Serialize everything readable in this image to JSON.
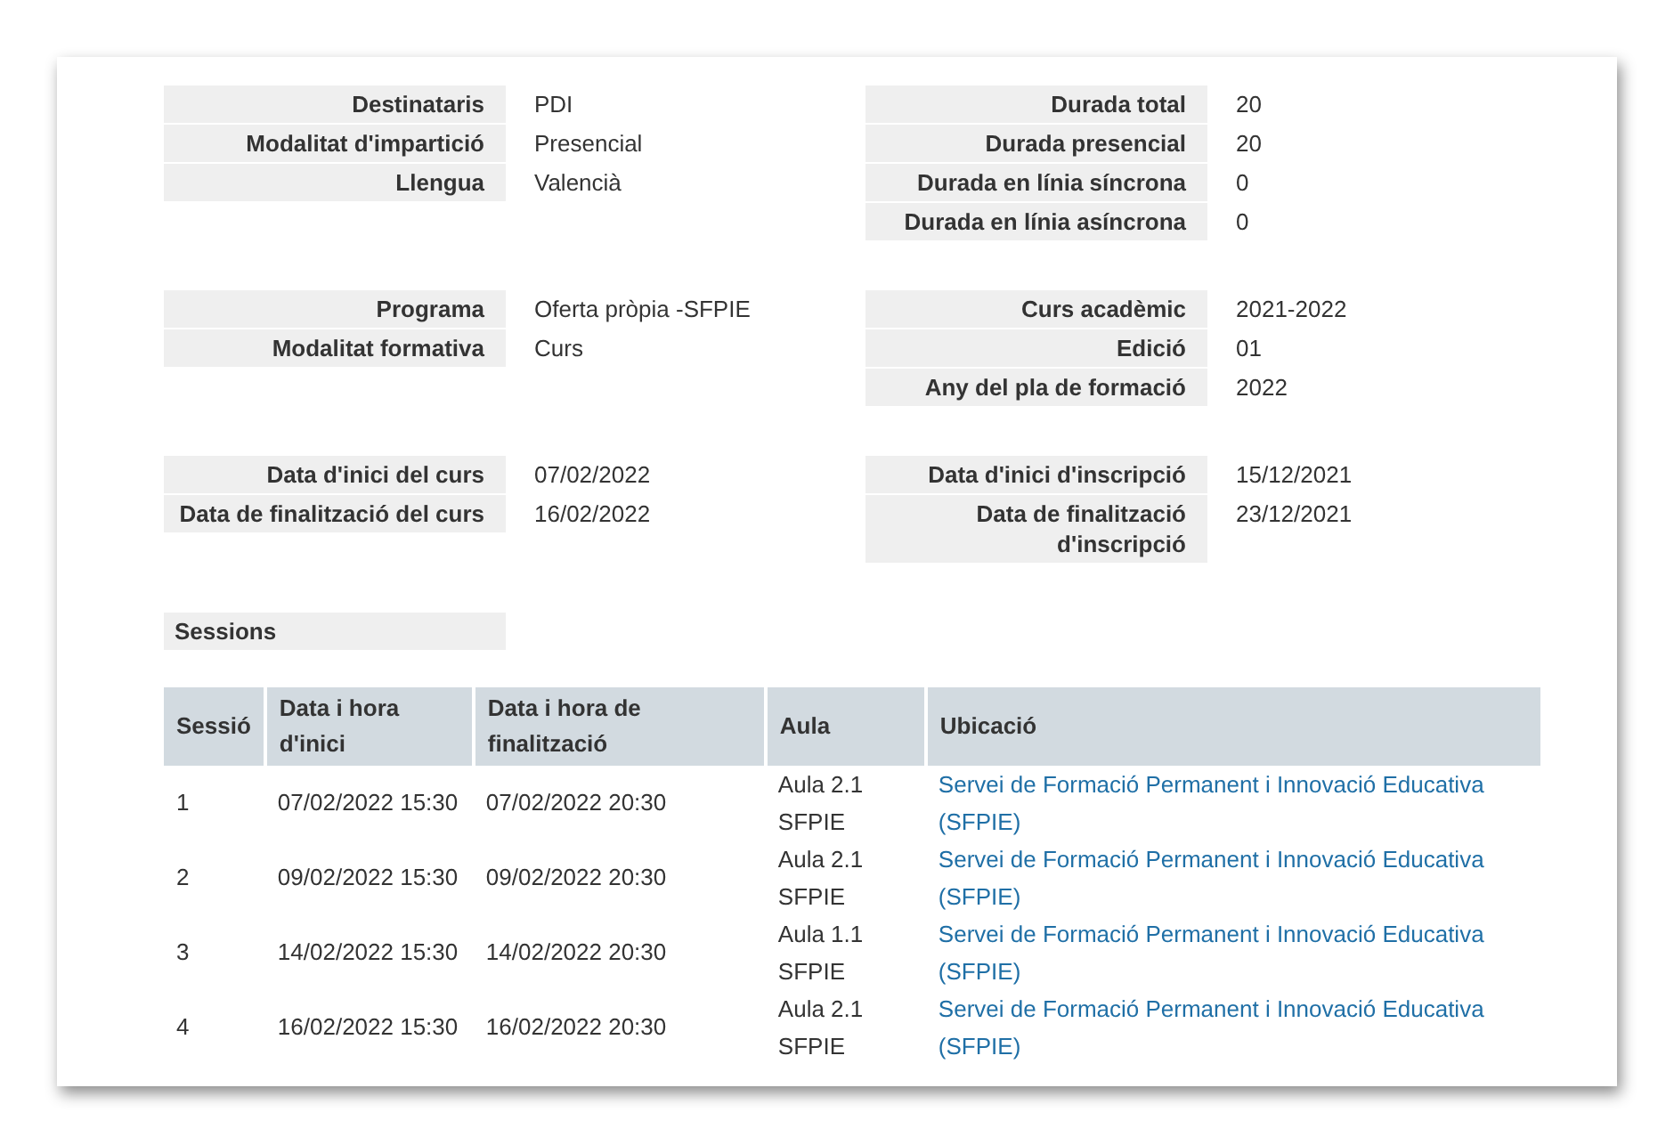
{
  "sections": [
    {
      "left": [
        {
          "label": "Destinataris",
          "value": "PDI"
        },
        {
          "label": "Modalitat d'impartició",
          "value": "Presencial"
        },
        {
          "label": "Llengua",
          "value": "Valencià"
        }
      ],
      "right": [
        {
          "label": "Durada total",
          "value": "20"
        },
        {
          "label": "Durada presencial",
          "value": "20"
        },
        {
          "label": "Durada en línia síncrona",
          "value": "0"
        },
        {
          "label": "Durada en línia asíncrona",
          "value": "0"
        }
      ]
    },
    {
      "left": [
        {
          "label": "Programa",
          "value": "Oferta pròpia -SFPIE"
        },
        {
          "label": "Modalitat formativa",
          "value": "Curs"
        }
      ],
      "right": [
        {
          "label": "Curs acadèmic",
          "value": "2021-2022"
        },
        {
          "label": "Edició",
          "value": "01"
        },
        {
          "label": "Any del pla de formació",
          "value": "2022"
        }
      ]
    },
    {
      "left": [
        {
          "label": "Data d'inici del curs",
          "value": "07/02/2022"
        },
        {
          "label": "Data de finalització del curs",
          "value": "16/02/2022"
        }
      ],
      "right": [
        {
          "label": "Data d'inici d'inscripció",
          "value": "15/12/2021"
        },
        {
          "label": "Data de finalització d'inscripció",
          "value": "23/12/2021"
        }
      ]
    }
  ],
  "sessions_label": "Sessions",
  "table": {
    "columns": [
      "Sessió",
      "Data i hora d'inici",
      "Data i hora de finalització",
      "Aula",
      "Ubicació"
    ],
    "rows": [
      {
        "session": "1",
        "start": "07/02/2022 15:30",
        "end": "07/02/2022 20:30",
        "room": "Aula 2.1 SFPIE",
        "location": "Servei de Formació Permanent i Innovació Educativa (SFPIE)"
      },
      {
        "session": "2",
        "start": "09/02/2022 15:30",
        "end": "09/02/2022 20:30",
        "room": "Aula 2.1 SFPIE",
        "location": "Servei de Formació Permanent i Innovació Educativa (SFPIE)"
      },
      {
        "session": "3",
        "start": "14/02/2022 15:30",
        "end": "14/02/2022 20:30",
        "room": "Aula 1.1 SFPIE",
        "location": "Servei de Formació Permanent i Innovació Educativa (SFPIE)"
      },
      {
        "session": "4",
        "start": "16/02/2022 15:30",
        "end": "16/02/2022 20:30",
        "room": "Aula 2.1 SFPIE",
        "location": "Servei de Formació Permanent i Innovació Educativa (SFPIE)"
      }
    ]
  }
}
